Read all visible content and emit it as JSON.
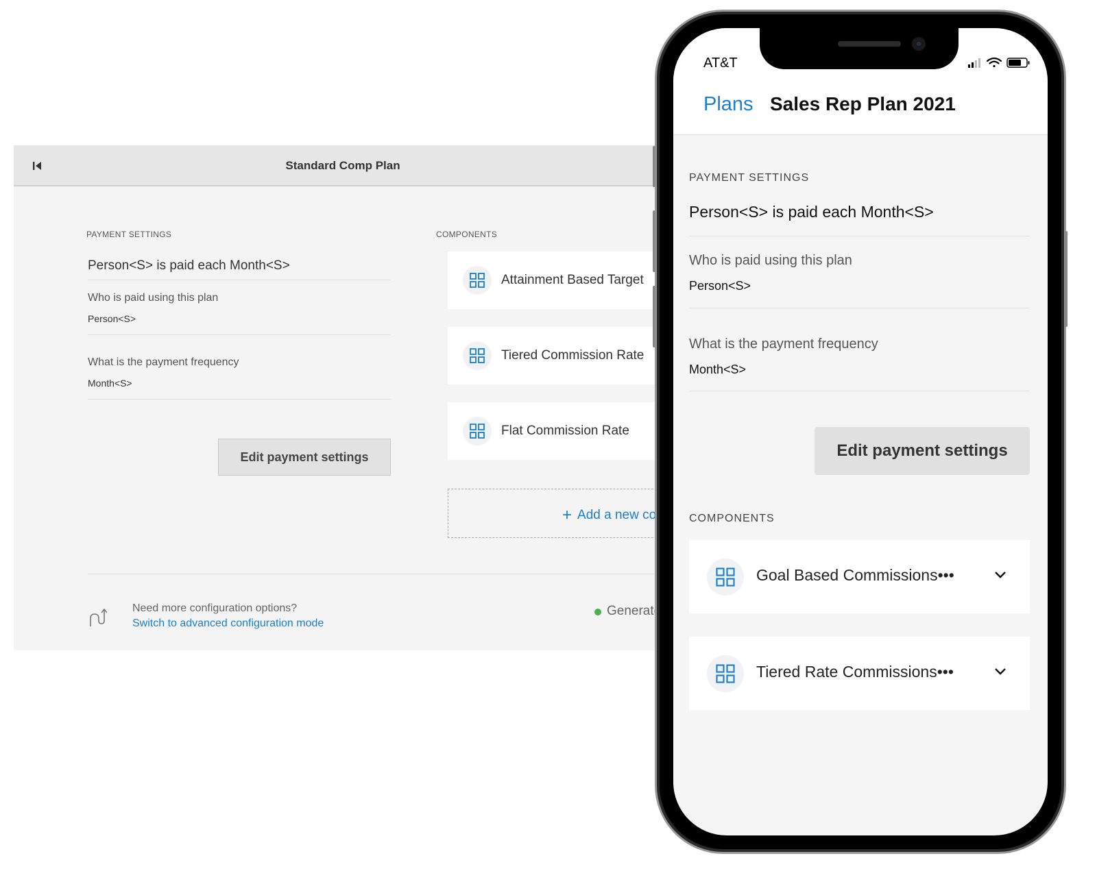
{
  "desktop": {
    "title": "Standard Comp Plan",
    "payment_settings": {
      "section_label": "PAYMENT SETTINGS",
      "summary": "Person<S> is paid each Month<S>",
      "who_label": "Who is paid using this plan",
      "who_value": "Person<S>",
      "frequency_label": "What is the payment frequency",
      "frequency_value": "Month<S>",
      "edit_button": "Edit payment settings"
    },
    "components": {
      "section_label": "COMPONENTS",
      "items": [
        {
          "name": "Attainment Based Target",
          "icon": "grid-icon"
        },
        {
          "name": "Tiered Commission Rate",
          "icon": "grid-icon"
        },
        {
          "name": "Flat Commission Rate",
          "icon": "grid-icon"
        }
      ],
      "add_label": "Add a new com",
      "add_icon": "+"
    },
    "footer": {
      "need_more": "Need more configuration options?",
      "switch_link": "Switch to advanced configuration mode",
      "status": "Generated"
    }
  },
  "mobile": {
    "status_bar": {
      "carrier": "AT&T"
    },
    "nav": {
      "back_label": "Plans",
      "title": "Sales Rep Plan 2021"
    },
    "payment_settings": {
      "section_label": "PAYMENT SETTINGS",
      "summary": "Person<S> is paid each Month<S>",
      "who_label": "Who is paid using this plan",
      "who_value": "Person<S>",
      "frequency_label": "What is the payment frequency",
      "frequency_value": "Month<S>",
      "edit_button": "Edit payment settings"
    },
    "components": {
      "section_label": "COMPONENTS",
      "items": [
        {
          "name": "Goal Based Commissions•••",
          "icon": "grid-icon"
        },
        {
          "name": "Tiered Rate Commissions•••",
          "icon": "grid-icon"
        }
      ]
    }
  },
  "colors": {
    "accent": "#1a7fd0",
    "status_ok": "#4caf50",
    "panel_bg": "#f4f4f4",
    "header_bg": "#e6e6e6"
  }
}
